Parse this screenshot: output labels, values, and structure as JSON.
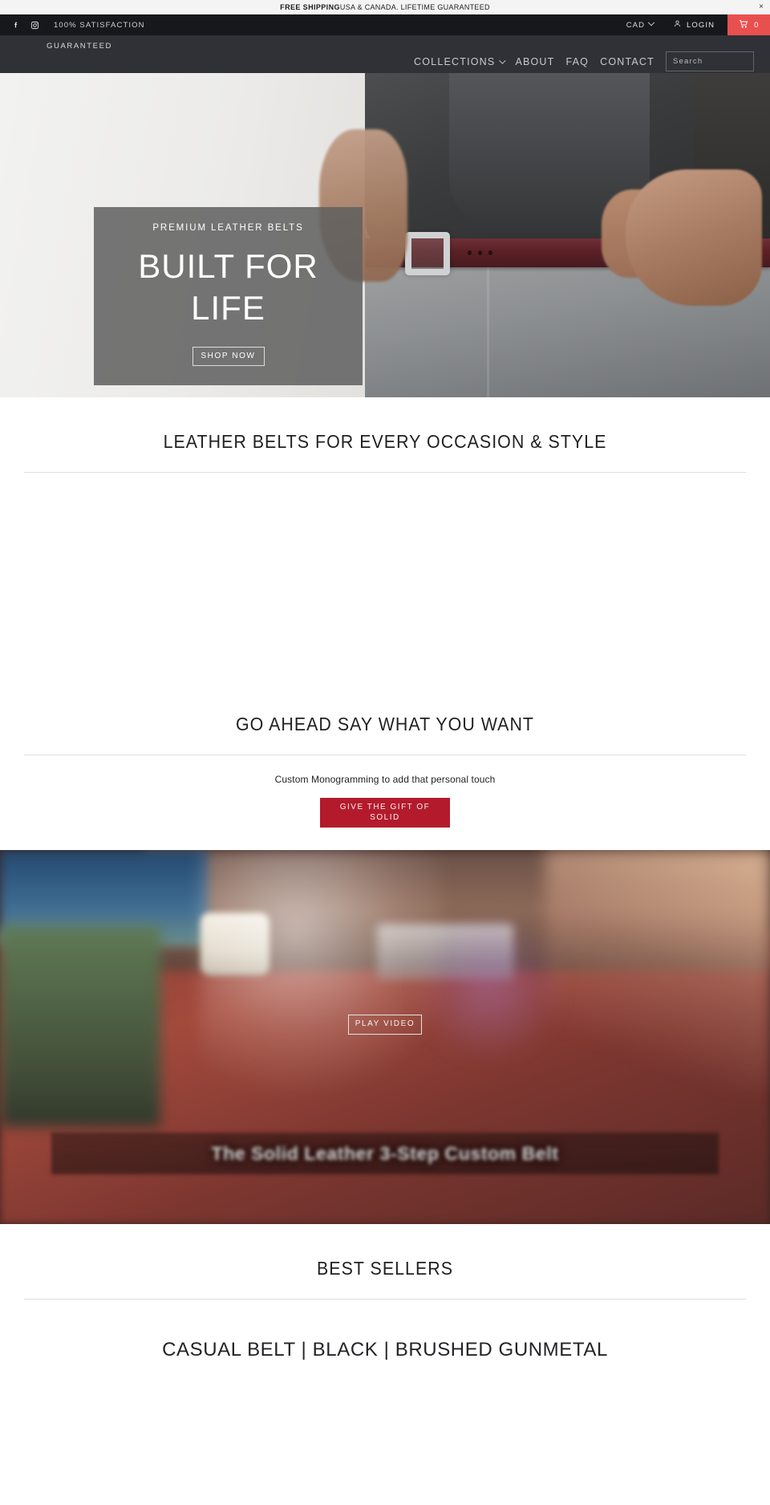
{
  "announcement": {
    "strong_text": "FREE SHIPPING",
    "rest_text": "USA & CANADA. LIFETIME GUARANTEED",
    "close_label": "×",
    "close_icon": "close-icon"
  },
  "utility_bar": {
    "facebook_icon": "facebook-icon",
    "instagram_icon": "instagram-icon",
    "tagline": "100% SATISFACTION",
    "currency": "CAD",
    "currency_caret_icon": "chevron-down-icon",
    "account_icon": "user-icon",
    "login_label": "LOGIN",
    "cart_icon": "shopping-cart-icon",
    "cart_count": "0"
  },
  "nav": {
    "logo_text": "GUARANTEED",
    "links": [
      {
        "label": "COLLECTIONS",
        "has_dropdown": true
      },
      {
        "label": "ABOUT",
        "has_dropdown": false
      },
      {
        "label": "FAQ",
        "has_dropdown": false
      },
      {
        "label": "CONTACT",
        "has_dropdown": false
      }
    ],
    "search_placeholder": "Search",
    "search_value": "",
    "search_icon": "search-icon"
  },
  "hero": {
    "kicker": "PREMIUM LEATHER BELTS",
    "title": "BUILT FOR LIFE",
    "cta_label": "SHOP NOW",
    "overlay_color": "#606060"
  },
  "sections": {
    "collections": {
      "title": "LEATHER BELTS FOR EVERY OCCASION & STYLE"
    },
    "monogram": {
      "title": "GO AHEAD SAY WHAT YOU WANT",
      "subtitle": "Custom Monogramming to add that personal touch",
      "cta_label": "GIVE THE GIFT OF SOLID",
      "cta_color": "#b31b2c"
    },
    "video": {
      "play_label": "PLAY VIDEO",
      "caption": "The Solid Leather 3-Step Custom Belt"
    },
    "best_sellers": {
      "title": "BEST SELLERS",
      "products": [
        {
          "title": "CASUAL BELT | BLACK | BRUSHED GUNMETAL"
        }
      ]
    }
  }
}
